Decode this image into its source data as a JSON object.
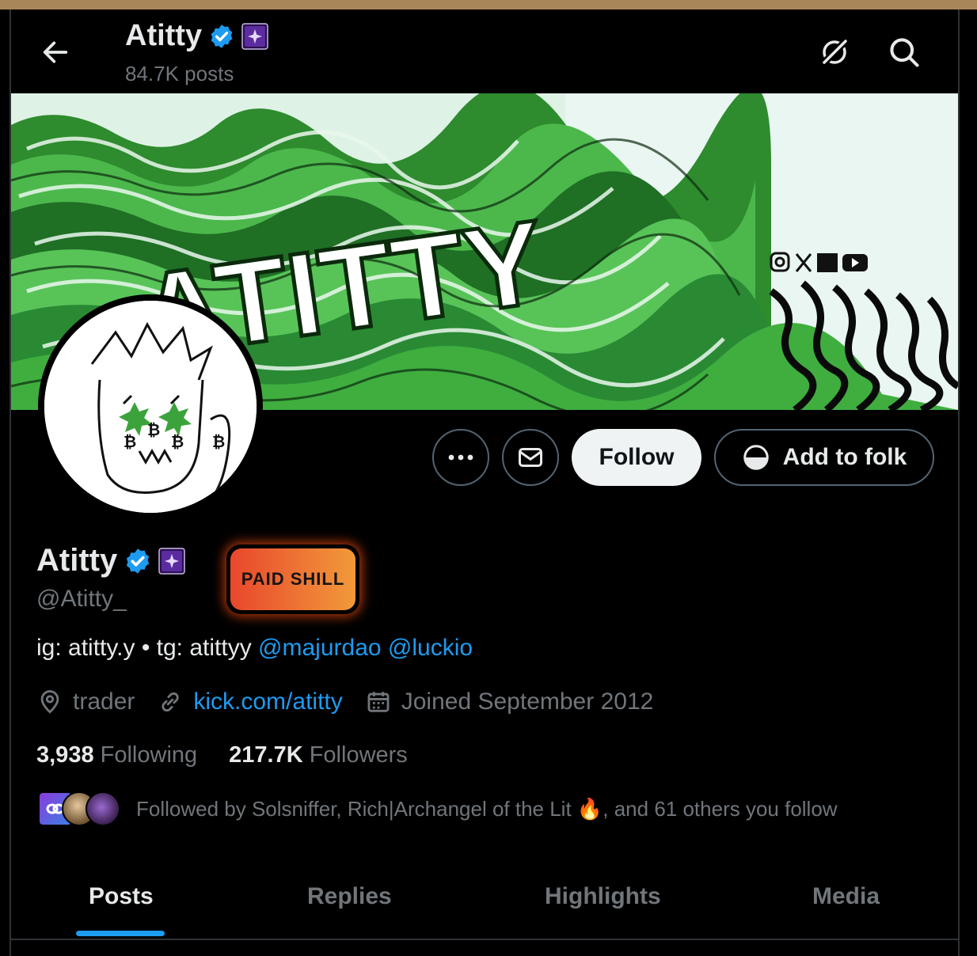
{
  "header": {
    "title": "Atitty",
    "posts_count": "84.7K posts",
    "back_icon": "arrow-left-icon",
    "grok_icon": "grok-icon",
    "search_icon": "search-icon"
  },
  "banner": {
    "text": "ATITTY",
    "social_icons": [
      "instagram-icon",
      "x-icon",
      "kick-icon",
      "youtube-icon"
    ],
    "colors": {
      "green": "#3aa63a",
      "light": "#e8f5f0",
      "dark": "#0a0a0a"
    }
  },
  "actions": {
    "more_icon": "more-dots-icon",
    "message_icon": "envelope-icon",
    "follow_label": "Follow",
    "folk_label": "Add to folk"
  },
  "profile": {
    "name": "Atitty",
    "handle": "@Atitty_",
    "badge_label": "PAID SHILL",
    "bio_text": "ig: atitty.y • tg: atittyy ",
    "bio_mention_1": "@majurdao",
    "bio_mention_2": "@luckio",
    "location": "trader",
    "website": "kick.com/atitty",
    "joined": "Joined September 2012",
    "following_count": "3,938",
    "following_label": "Following",
    "followers_count": "217.7K",
    "followers_label": "Followers",
    "followed_by": "Followed by Solsniffer, Rich|Archangel of the Lit 🔥, and 61 others you follow"
  },
  "tabs": [
    {
      "label": "Posts"
    },
    {
      "label": "Replies"
    },
    {
      "label": "Highlights"
    },
    {
      "label": "Media"
    }
  ],
  "colors": {
    "accent": "#1d9bf0",
    "verified": "#1d9bf0",
    "muted": "#71767b",
    "shill_start": "#e9472c",
    "shill_end": "#f19a3a"
  }
}
